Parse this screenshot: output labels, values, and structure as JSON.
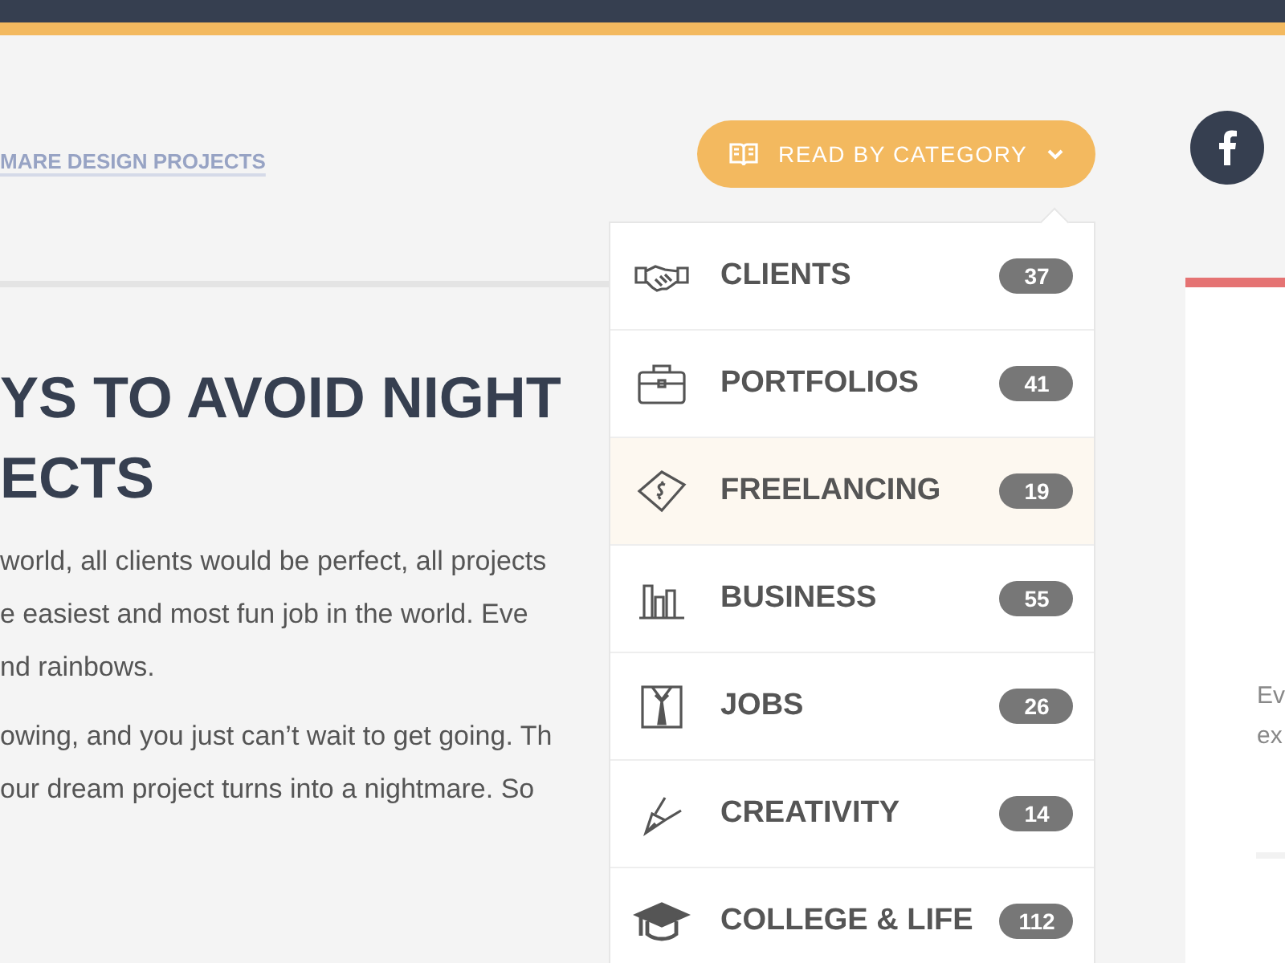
{
  "breadcrumb": "MARE DESIGN PROJECTS",
  "category_button": {
    "label": "READ BY CATEGORY",
    "expanded": true
  },
  "categories": [
    {
      "label": "CLIENTS",
      "count": "37",
      "selected": false
    },
    {
      "label": "PORTFOLIOS",
      "count": "41",
      "selected": false
    },
    {
      "label": "FREELANCING",
      "count": "19",
      "selected": true
    },
    {
      "label": "BUSINESS",
      "count": "55",
      "selected": false
    },
    {
      "label": "JOBS",
      "count": "26",
      "selected": false
    },
    {
      "label": "CREATIVITY",
      "count": "14",
      "selected": false
    },
    {
      "label": "COLLEGE & LIFE",
      "count": "112",
      "selected": false
    }
  ],
  "article": {
    "title_lines": [
      "YS TO AVOID NIGHT",
      "ECTS"
    ],
    "paragraphs": [
      [
        "world, all clients would be perfect, all projects",
        "e easiest and most fun job in the world. Eve",
        "nd rainbows."
      ],
      [
        "owing, and you just can’t wait to get going. Th",
        "our dream project turns into a nightmare. So"
      ]
    ]
  },
  "side_card": {
    "lines": [
      "Ev",
      "ex"
    ]
  }
}
